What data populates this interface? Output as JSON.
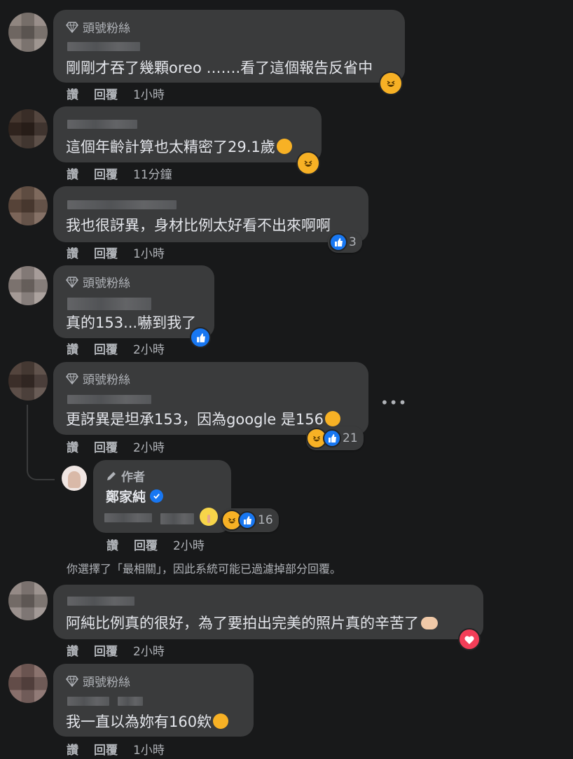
{
  "badge_label": "頭號粉絲",
  "action_like": "讚",
  "action_reply": "回覆",
  "author_label": "作者",
  "filter_note": "你選擇了「最相關」，因此系統可能已過濾掉部分回覆。",
  "comments": [
    {
      "text": "剛剛才吞了幾顆oreo …….看了這個報告反省中",
      "time": "1小時"
    },
    {
      "text": "這個年齡計算也太精密了29.1歲",
      "time": "11分鐘"
    },
    {
      "text": "我也很訝異，身材比例太好看不出來啊啊",
      "time": "1小時",
      "reaction_count": "3"
    },
    {
      "text": "真的153...嚇到我了",
      "time": "2小時"
    },
    {
      "text": "更訝異是坦承153，因為google 是156",
      "time": "2小時",
      "reaction_count": "21"
    },
    {
      "text": "阿純比例真的很好，為了要拍出完美的照片真的辛苦了",
      "time": "2小時"
    },
    {
      "text": "我一直以為妳有160欸",
      "time": "1小時"
    }
  ],
  "reply": {
    "author_name": "鄭家純",
    "time": "2小時",
    "reaction_count": "16"
  },
  "colors": {
    "background": "#18191a",
    "bubble": "#3a3b3c",
    "text": "#e4e6eb",
    "muted": "#b0b3b8",
    "like": "#1877f2",
    "laugh": "#f7b125",
    "love": "#f33e58"
  }
}
